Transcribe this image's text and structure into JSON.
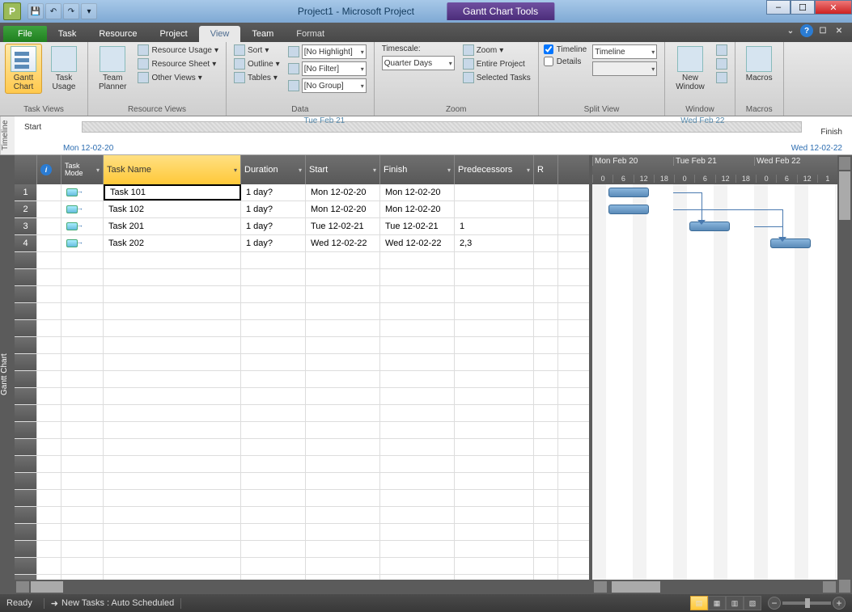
{
  "titlebar": {
    "logo_letter": "P",
    "title": "Project1  -  Microsoft Project",
    "contextual_tab": "Gantt Chart Tools"
  },
  "menu": {
    "file": "File",
    "tabs": [
      "Task",
      "Resource",
      "Project",
      "View",
      "Team",
      "Format"
    ],
    "active": "View"
  },
  "ribbon": {
    "task_views": {
      "label": "Task Views",
      "gantt": "Gantt\nChart",
      "task_usage": "Task\nUsage"
    },
    "resource_views": {
      "label": "Resource Views",
      "team_planner": "Team\nPlanner",
      "resource_usage": "Resource Usage",
      "resource_sheet": "Resource Sheet",
      "other_views": "Other Views"
    },
    "data": {
      "label": "Data",
      "sort": "Sort",
      "outline": "Outline",
      "tables": "Tables",
      "highlight": "[No Highlight]",
      "filter": "[No Filter]",
      "group": "[No Group]"
    },
    "zoom": {
      "label": "Zoom",
      "timescale": "Timescale:",
      "timescale_value": "Quarter Days",
      "zoom_btn": "Zoom",
      "entire_project": "Entire Project",
      "selected_tasks": "Selected Tasks"
    },
    "split_view": {
      "label": "Split View",
      "timeline_chk": "Timeline",
      "timeline_combo": "Timeline",
      "details_chk": "Details"
    },
    "window": {
      "label": "Window",
      "new_window": "New\nWindow"
    },
    "macros": {
      "label": "Macros",
      "macros_btn": "Macros"
    }
  },
  "timeline": {
    "side_label": "Timeline",
    "start_label": "Start",
    "start_date": "Mon 12-02-20",
    "finish_label": "Finish",
    "finish_date": "Wed 12-02-22",
    "mid1": "Tue Feb 21",
    "mid2": "Wed Feb 22"
  },
  "grid": {
    "side_label": "Gantt Chart",
    "headers": {
      "info": "",
      "mode": "Task Mode",
      "name": "Task Name",
      "duration": "Duration",
      "start": "Start",
      "finish": "Finish",
      "predecessors": "Predecessors",
      "resources": "R"
    },
    "rows": [
      {
        "n": "1",
        "name": "Task 101",
        "duration": "1 day?",
        "start": "Mon 12-02-20",
        "finish": "Mon 12-02-20",
        "pred": ""
      },
      {
        "n": "2",
        "name": "Task 102",
        "duration": "1 day?",
        "start": "Mon 12-02-20",
        "finish": "Mon 12-02-20",
        "pred": ""
      },
      {
        "n": "3",
        "name": "Task 201",
        "duration": "1 day?",
        "start": "Tue 12-02-21",
        "finish": "Tue 12-02-21",
        "pred": "1"
      },
      {
        "n": "4",
        "name": "Task 202",
        "duration": "1 day?",
        "start": "Wed 12-02-22",
        "finish": "Wed 12-02-22",
        "pred": "2,3"
      }
    ]
  },
  "gantt_header": {
    "days": [
      "Mon Feb 20",
      "Tue Feb 21",
      "Wed Feb 22"
    ],
    "hours": [
      "0",
      "6",
      "12",
      "18",
      "0",
      "6",
      "12",
      "18",
      "0",
      "6",
      "12",
      "1"
    ]
  },
  "status": {
    "ready": "Ready",
    "new_tasks": "New Tasks : Auto Scheduled"
  },
  "chart_data": {
    "type": "gantt",
    "timescale_unit": "hours",
    "tasks": [
      {
        "id": 1,
        "name": "Task 101",
        "start": "2012-02-20T00:00",
        "end": "2012-02-20T12:00",
        "row": 1
      },
      {
        "id": 2,
        "name": "Task 102",
        "start": "2012-02-20T00:00",
        "end": "2012-02-20T12:00",
        "row": 2
      },
      {
        "id": 3,
        "name": "Task 201",
        "start": "2012-02-21T00:00",
        "end": "2012-02-21T12:00",
        "row": 3,
        "predecessors": [
          1
        ]
      },
      {
        "id": 4,
        "name": "Task 202",
        "start": "2012-02-22T00:00",
        "end": "2012-02-22T12:00",
        "row": 4,
        "predecessors": [
          2,
          3
        ]
      }
    ],
    "x_range": [
      "2012-02-20T00:00",
      "2012-02-22T18:00"
    ]
  }
}
